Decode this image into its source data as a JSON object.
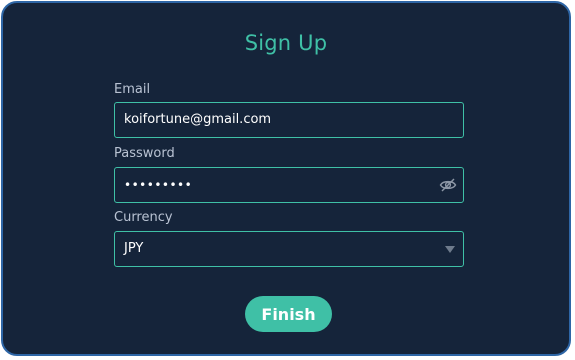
{
  "form": {
    "title": "Sign Up",
    "email": {
      "label": "Email",
      "value": "koifortune@gmail.com"
    },
    "password": {
      "label": "Password",
      "masked_value": "•••••••••",
      "toggle_icon": "eye-slash-icon"
    },
    "currency": {
      "label": "Currency",
      "selected": "JPY",
      "dropdown_icon": "caret-down-icon"
    },
    "submit_label": "Finish"
  },
  "colors": {
    "background": "#15243a",
    "border": "#2e66a6",
    "accent": "#3fc0a6",
    "label_text": "#b9c3d3"
  }
}
